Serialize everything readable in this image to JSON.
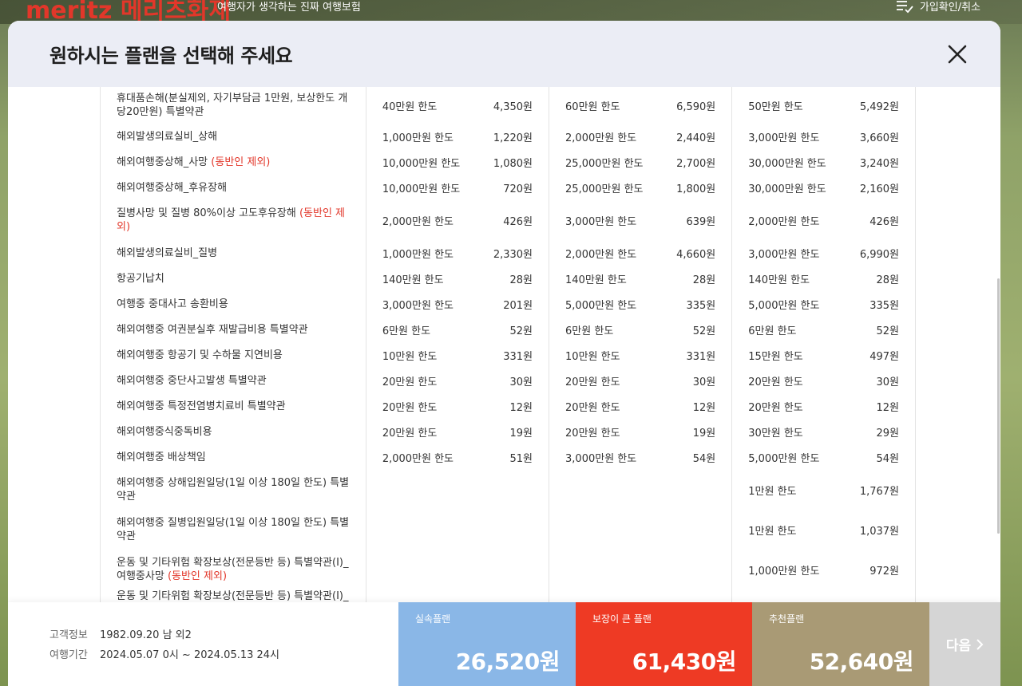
{
  "bg_header": {
    "logo": "meritz 메리츠화재",
    "tagline": "여행자가 생각하는 진짜 여행보험",
    "right_link": "가입확인/취소",
    "right_icon": "list-check-icon"
  },
  "modal": {
    "title": "원하시는 플랜을 선택해 주세요",
    "close_icon": "close-icon"
  },
  "coverage_rows": [
    {
      "name": "휴대품손해(분실제외, 자기부담금 1만원, 보상한도 개당20만원) 특별약관",
      "tag": "",
      "p1_limit": "40만원 한도",
      "p1_price": "4,350원",
      "p2_limit": "60만원 한도",
      "p2_price": "6,590원",
      "p3_limit": "50만원 한도",
      "p3_price": "5,492원"
    },
    {
      "name": "해외발생의료실비_상해",
      "tag": "",
      "p1_limit": "1,000만원 한도",
      "p1_price": "1,220원",
      "p2_limit": "2,000만원 한도",
      "p2_price": "2,440원",
      "p3_limit": "3,000만원 한도",
      "p3_price": "3,660원"
    },
    {
      "name": "해외여행중상해_사망 ",
      "tag": "(동반인 제외)",
      "p1_limit": "10,000만원 한도",
      "p1_price": "1,080원",
      "p2_limit": "25,000만원 한도",
      "p2_price": "2,700원",
      "p3_limit": "30,000만원 한도",
      "p3_price": "3,240원"
    },
    {
      "name": "해외여행중상해_후유장해",
      "tag": "",
      "p1_limit": "10,000만원 한도",
      "p1_price": "720원",
      "p2_limit": "25,000만원 한도",
      "p2_price": "1,800원",
      "p3_limit": "30,000만원 한도",
      "p3_price": "2,160원"
    },
    {
      "name": "질병사망 및 질병 80%이상 고도후유장해 ",
      "tag": "(동반인 제외)",
      "p1_limit": "2,000만원 한도",
      "p1_price": "426원",
      "p2_limit": "3,000만원 한도",
      "p2_price": "639원",
      "p3_limit": "2,000만원 한도",
      "p3_price": "426원"
    },
    {
      "name": "해외발생의료실비_질병",
      "tag": "",
      "p1_limit": "1,000만원 한도",
      "p1_price": "2,330원",
      "p2_limit": "2,000만원 한도",
      "p2_price": "4,660원",
      "p3_limit": "3,000만원 한도",
      "p3_price": "6,990원"
    },
    {
      "name": "항공기납치",
      "tag": "",
      "p1_limit": "140만원 한도",
      "p1_price": "28원",
      "p2_limit": "140만원 한도",
      "p2_price": "28원",
      "p3_limit": "140만원 한도",
      "p3_price": "28원"
    },
    {
      "name": "여행중 중대사고 송환비용",
      "tag": "",
      "p1_limit": "3,000만원 한도",
      "p1_price": "201원",
      "p2_limit": "5,000만원 한도",
      "p2_price": "335원",
      "p3_limit": "5,000만원 한도",
      "p3_price": "335원"
    },
    {
      "name": "해외여행중 여권분실후 재발급비용 특별약관",
      "tag": "",
      "p1_limit": "6만원 한도",
      "p1_price": "52원",
      "p2_limit": "6만원 한도",
      "p2_price": "52원",
      "p3_limit": "6만원 한도",
      "p3_price": "52원"
    },
    {
      "name": "해외여행중 항공기 및 수하물 지연비용",
      "tag": "",
      "p1_limit": "10만원 한도",
      "p1_price": "331원",
      "p2_limit": "10만원 한도",
      "p2_price": "331원",
      "p3_limit": "15만원 한도",
      "p3_price": "497원"
    },
    {
      "name": "해외여행중 중단사고발생 특별약관",
      "tag": "",
      "p1_limit": "20만원 한도",
      "p1_price": "30원",
      "p2_limit": "20만원 한도",
      "p2_price": "30원",
      "p3_limit": "20만원 한도",
      "p3_price": "30원"
    },
    {
      "name": "해외여행중 특정전염병치료비 특별약관",
      "tag": "",
      "p1_limit": "20만원 한도",
      "p1_price": "12원",
      "p2_limit": "20만원 한도",
      "p2_price": "12원",
      "p3_limit": "20만원 한도",
      "p3_price": "12원"
    },
    {
      "name": "해외여행중식중독비용",
      "tag": "",
      "p1_limit": "20만원 한도",
      "p1_price": "19원",
      "p2_limit": "20만원 한도",
      "p2_price": "19원",
      "p3_limit": "30만원 한도",
      "p3_price": "29원"
    },
    {
      "name": "해외여행중 배상책임",
      "tag": "",
      "p1_limit": "2,000만원 한도",
      "p1_price": "51원",
      "p2_limit": "3,000만원 한도",
      "p2_price": "54원",
      "p3_limit": "5,000만원 한도",
      "p3_price": "54원"
    },
    {
      "name": "해외여행중 상해입원일당(1일 이상 180일 한도) 특별약관",
      "tag": "",
      "p1_limit": "",
      "p1_price": "",
      "p2_limit": "",
      "p2_price": "",
      "p3_limit": "1만원 한도",
      "p3_price": "1,767원"
    },
    {
      "name": "해외여행중 질병입원일당(1일 이상 180일 한도) 특별약관",
      "tag": "",
      "p1_limit": "",
      "p1_price": "",
      "p2_limit": "",
      "p2_price": "",
      "p3_limit": "1만원 한도",
      "p3_price": "1,037원"
    },
    {
      "name": "운동 및 기타위험 확장보상(전문등반 등) 특별약관(I)_여행중사망 ",
      "tag": "(동반인 제외)",
      "p1_limit": "",
      "p1_price": "",
      "p2_limit": "",
      "p2_price": "",
      "p3_limit": "1,000만원 한도",
      "p3_price": "972원"
    },
    {
      "name": "운동 및 기타위험 확장보상(전문등반 등) 특별약관(I)_",
      "tag": "",
      "p1_limit": "",
      "p1_price": "",
      "p2_limit": "",
      "p2_price": "",
      "p3_limit": "",
      "p3_price": ""
    }
  ],
  "customer": {
    "info_label": "고객정보",
    "info_value": "1982.09.20 남 외2",
    "period_label": "여행기간",
    "period_value": "2024.05.07 0시 ~ 2024.05.13 24시"
  },
  "plans": [
    {
      "name": "실속플랜",
      "price": "26,520원",
      "color": "#8ab7e7"
    },
    {
      "name": "보장이 큰 플랜",
      "price": "61,430원",
      "color": "#ee3a24"
    },
    {
      "name": "추천플랜",
      "price": "52,640원",
      "color": "#a99a75"
    }
  ],
  "next_button": {
    "label": "다음",
    "icon": "chevron-right-icon"
  }
}
